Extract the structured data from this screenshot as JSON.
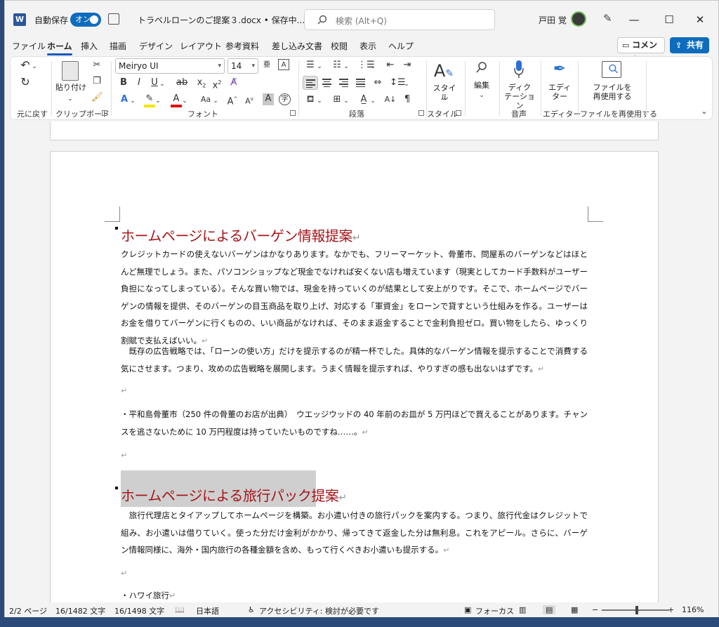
{
  "titlebar": {
    "app_icon_letter": "W",
    "autosave_label": "自動保存",
    "autosave_state": "オン",
    "doc_title": "トラベルローンのご提案３.docx • 保存中... ⌄",
    "search_placeholder": "検索 (Alt+Q)",
    "user_name": "戸田 覚",
    "controls": {
      "minimize": "—",
      "maximize": "☐",
      "close": "✕"
    }
  },
  "tabs": [
    "ファイル",
    "ホーム",
    "挿入",
    "描画",
    "デザイン",
    "レイアウト",
    "参考資料",
    "差し込み文書",
    "校閲",
    "表示",
    "ヘルプ"
  ],
  "active_tab": "ホーム",
  "comment_label": "コメント",
  "share_label": "共有",
  "ribbon": {
    "undo_group_label": "元に戻す",
    "clipboard": {
      "label": "クリップボード",
      "paste_label": "貼り付け"
    },
    "font": {
      "label": "フォント",
      "name": "Meiryo UI",
      "size": "14"
    },
    "paragraph_label": "段落",
    "styles": {
      "label": "スタイル",
      "button": "スタイル"
    },
    "editing_label": "編集",
    "voice": {
      "label": "音声",
      "button_line1": "ディク",
      "button_line2": "テーション"
    },
    "editor": {
      "label": "エディター",
      "button_line1": "エディ",
      "button_line2": "ター"
    },
    "reuse": {
      "label": "ファイルを再使用する",
      "button_line1": "ファイルを",
      "button_line2": "再使用する"
    }
  },
  "document": {
    "heading1": "ホームページによるバーゲン情報提案",
    "para1": "クレジットカードの使えないバーゲンはかなりあります。なかでも、フリーマーケット、骨董市、問屋系のバーゲンなどはほとんど無理でしょう。また、パソコンショップなど現金でなければ安くない店も増えています（現実としてカード手数料がユーザー負担になってしまっている）。そんな買い物では、現金を持っていくのが結果として安上がりです。そこで、ホームページでバーゲンの情報を提供、そのバーゲンの目玉商品を取り上げ、対応する「軍資金」をローンで貸すという仕組みを作る。ユーザーはお金を借りてバーゲンに行くものの、いい商品がなければ、そのまま返金することで金利負担ゼロ。買い物をしたら、ゆっくり割賦で支払えばいい。",
    "para2": "　既存の広告戦略では、「ローンの使い方」だけを提示するのが精一杯でした。具体的なバーゲン情報を提示することで消費する気にさせます。つまり、攻めの広告戦略を展開します。うまく情報を提示すれば、やりすぎの感も出ないはずです。",
    "para3": "・平和島骨董市（250 件の骨董のお店が出典）　ウエッジウッドの 40 年前のお皿が 5 万円ほどで買えることがあります。チャンスを逃さないために 10 万円程度は持っていたいものですね……。",
    "heading2": "ホームページによる旅行パック提案",
    "para4": "　旅行代理店とタイアップしてホームページを構築。お小遣い付きの旅行パックを案内する。つまり、旅行代金はクレジットで組み、お小遣いは借りていく。使った分だけ金利がかかり、帰ってきて返金した分は無利息。これをアピール。さらに、バーゲン情報同様に、海外・国内旅行の各種金額を含め、もって行くべきお小遣いも提示する。",
    "para5": "・ハワイ旅行",
    "para_mark": "↵"
  },
  "statusbar": {
    "page": "2/2 ページ",
    "words1": "16/1482 文字",
    "words2": "16/1498 文字",
    "language": "日本語",
    "accessibility": "アクセシビリティ: 検討が必要です",
    "focus": "フォーカス",
    "zoom": "116%",
    "zoom_minus": "−",
    "zoom_plus": "+"
  }
}
